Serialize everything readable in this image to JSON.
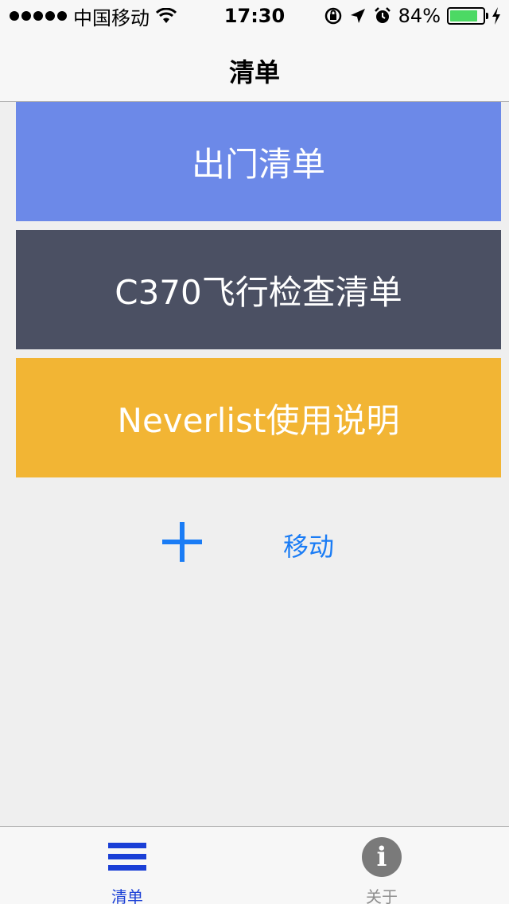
{
  "status_bar": {
    "carrier": "中国移动",
    "time": "17:30",
    "battery_percent": "84%",
    "battery_level": 0.84,
    "battery_color": "#4cd964"
  },
  "nav": {
    "title": "清单"
  },
  "lists": [
    {
      "label": "出门清单",
      "color": "#6c89e8"
    },
    {
      "label": "C370飞行检查清单",
      "color": "#4b5063"
    },
    {
      "label": "Neverlist使用说明",
      "color": "#f2b534"
    }
  ],
  "actions": {
    "add_icon": "plus-icon",
    "move_label": "移动"
  },
  "tabs": [
    {
      "label": "清单",
      "icon": "list-icon",
      "active": true,
      "color": "#1a3fd6"
    },
    {
      "label": "关于",
      "icon": "info-icon",
      "active": false,
      "color": "#8e8e8e"
    }
  ],
  "accent_color": "#1a7cf5"
}
